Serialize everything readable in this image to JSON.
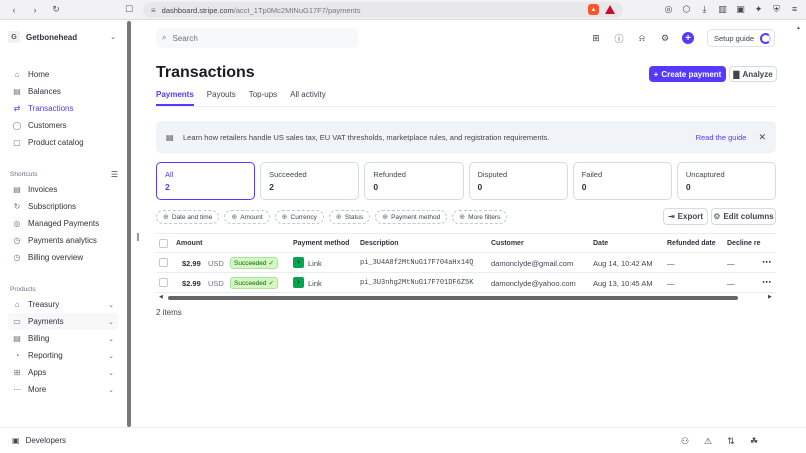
{
  "browser": {
    "url_host": "dashboard.stripe.com",
    "url_path": "/acct_1Tp0Mc2MtNuG17F7/payments",
    "icons": [
      "back-icon",
      "forward-icon",
      "reload-icon",
      "bookmark-icon",
      "tune-icon",
      "brave-shield-icon",
      "brave-rewards-icon"
    ]
  },
  "sidebar": {
    "account_initial": "G",
    "account_name": "Getbonehead",
    "main_items": [
      {
        "label": "Home",
        "icon": "home-icon"
      },
      {
        "label": "Balances",
        "icon": "balances-icon"
      },
      {
        "label": "Transactions",
        "icon": "transactions-icon",
        "active": true
      },
      {
        "label": "Customers",
        "icon": "customers-icon"
      },
      {
        "label": "Product catalog",
        "icon": "product-catalog-icon"
      }
    ],
    "shortcuts_title": "Shortcuts",
    "shortcuts": [
      {
        "label": "Invoices",
        "icon": "invoices-icon"
      },
      {
        "label": "Subscriptions",
        "icon": "subscriptions-icon"
      },
      {
        "label": "Managed Payments",
        "icon": "managed-payments-icon"
      },
      {
        "label": "Payments analytics",
        "icon": "payments-analytics-icon"
      },
      {
        "label": "Billing overview",
        "icon": "billing-overview-icon"
      }
    ],
    "products_title": "Products",
    "products": [
      {
        "label": "Treasury",
        "icon": "treasury-icon"
      },
      {
        "label": "Payments",
        "icon": "payments-icon"
      },
      {
        "label": "Billing",
        "icon": "billing-icon"
      },
      {
        "label": "Reporting",
        "icon": "reporting-icon"
      },
      {
        "label": "Apps",
        "icon": "apps-icon"
      },
      {
        "label": "More",
        "icon": "more-icon"
      }
    ]
  },
  "topbar": {
    "search_placeholder": "Search",
    "setup_guide_label": "Setup guide"
  },
  "page": {
    "title": "Transactions",
    "create_payment_label": "Create payment",
    "analyze_label": "Analyze",
    "tabs": [
      "Payments",
      "Payouts",
      "Top-ups",
      "All activity"
    ],
    "active_tab": "Payments"
  },
  "banner": {
    "text": "Learn how retailers handle US sales tax, EU VAT thresholds, marketplace rules, and registration requirements.",
    "link_label": "Read the guide"
  },
  "filter_cards": [
    {
      "label": "All",
      "count": "2",
      "active": true
    },
    {
      "label": "Succeeded",
      "count": "2"
    },
    {
      "label": "Refunded",
      "count": "0"
    },
    {
      "label": "Disputed",
      "count": "0"
    },
    {
      "label": "Failed",
      "count": "0"
    },
    {
      "label": "Uncaptured",
      "count": "0"
    }
  ],
  "filter_pills": [
    "Date and time",
    "Amount",
    "Currency",
    "Status",
    "Payment method",
    "More filters"
  ],
  "export_label": "Export",
  "edit_columns_label": "Edit columns",
  "table": {
    "columns": [
      "Amount",
      "Payment method",
      "Description",
      "Customer",
      "Date",
      "Refunded date",
      "Decline re"
    ],
    "rows": [
      {
        "amount": "$2.99",
        "currency": "USD",
        "status": "Succeeded",
        "method": "Link",
        "description": "pi_3U4A8f2MtNuG17F704aHx14Q",
        "customer": "damonclyde@gmail.com",
        "date": "Aug 14, 10:42 AM",
        "refunded": "—",
        "decline": "—"
      },
      {
        "amount": "$2.99",
        "currency": "USD",
        "status": "Succeeded",
        "method": "Link",
        "description": "pi_3U3nhg2MtNuG17F701DF6Z5K",
        "customer": "damonclyde@yahoo.com",
        "date": "Aug 13, 10:45 AM",
        "refunded": "—",
        "decline": "—"
      }
    ],
    "items_count": "2 items"
  },
  "bottombar": {
    "developers_label": "Developers"
  }
}
